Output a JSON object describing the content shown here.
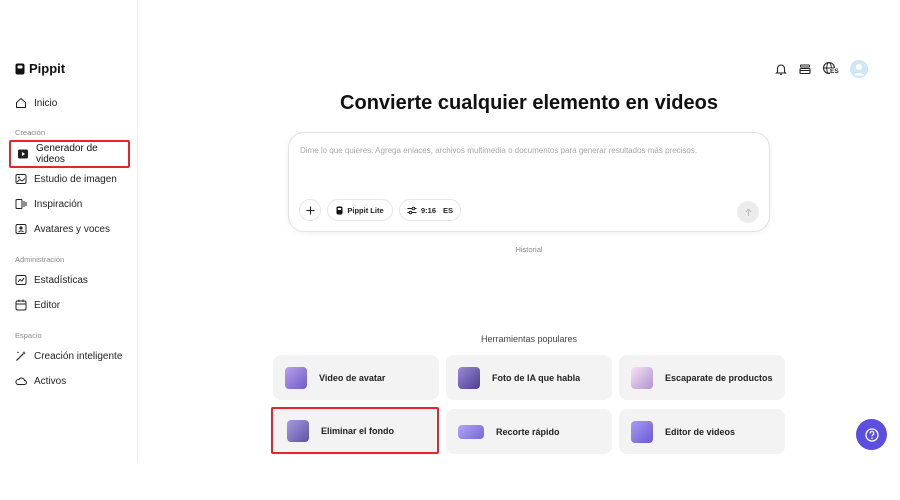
{
  "app": {
    "name": "Pippit"
  },
  "sidebar": {
    "home": "Inicio",
    "sections": {
      "creation": "Creación",
      "administration": "Administración",
      "space": "Espacio"
    },
    "items": [
      {
        "label": "Generador de videos",
        "icon": "video-generator-icon"
      },
      {
        "label": "Estudio de imagen",
        "icon": "image-studio-icon"
      },
      {
        "label": "Inspiración",
        "icon": "inspiration-icon"
      },
      {
        "label": "Avatares y voces",
        "icon": "avatar-voice-icon"
      },
      {
        "label": "Estadísticas",
        "icon": "stats-icon"
      },
      {
        "label": "Editor",
        "icon": "calendar-icon"
      },
      {
        "label": "Creación inteligente",
        "icon": "magic-wand-icon"
      },
      {
        "label": "Activos",
        "icon": "cloud-icon"
      }
    ]
  },
  "header": {
    "language_badge": "ES"
  },
  "main": {
    "headline": "Convierte cualquier elemento en videos",
    "prompt": {
      "placeholder": "Dime lo que quieres. Agrega enlaces, archivos multimedia o documentos para generar resultados más precisos.",
      "model": "Pippit Lite",
      "ratio": "9:16",
      "language": "ES"
    },
    "history": "Historial",
    "tools_label": "Herramientas populares",
    "tools": [
      {
        "label": "Video de avatar",
        "thumb_color": "#8c6fd6"
      },
      {
        "label": "Foto de IA que habla",
        "thumb_color": "#6a5bb8"
      },
      {
        "label": "Escaparate de productos",
        "thumb_color": "#c9a5d8"
      },
      {
        "label": "Eliminar el fondo",
        "thumb_color": "#7a6ec2"
      },
      {
        "label": "Recorte rápido",
        "thumb_color": "#8e7de0"
      },
      {
        "label": "Editor de videos",
        "thumb_color": "#7b6bd8"
      }
    ]
  },
  "colors": {
    "accent": "#5b4ee0",
    "highlight": "#e3262c",
    "card_bg": "#f3f3f3"
  }
}
